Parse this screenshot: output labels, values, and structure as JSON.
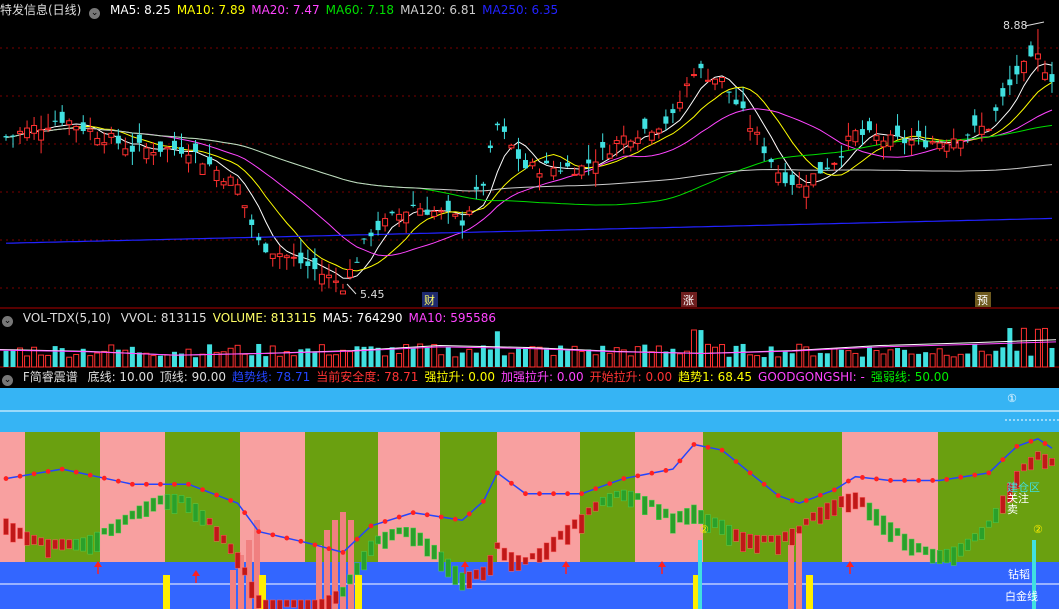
{
  "price_panel": {
    "title": "特发信息(日线)",
    "ma_legend": [
      {
        "label": "MA5: 8.25",
        "color": "#ffffff"
      },
      {
        "label": "MA10: 7.89",
        "color": "#ffff00"
      },
      {
        "label": "MA20: 7.47",
        "color": "#ff44ff"
      },
      {
        "label": "MA60: 7.18",
        "color": "#00dd00"
      },
      {
        "label": "MA120: 6.81",
        "color": "#cccccc"
      },
      {
        "label": "MA250: 6.35",
        "color": "#2222ff"
      }
    ],
    "high_label": "8.88",
    "low_label": "5.45",
    "markers": [
      "财",
      "涨",
      "预"
    ]
  },
  "volume_panel": {
    "title": "VOL-TDX(5,10)",
    "legend": [
      {
        "label": "VVOL: 813115",
        "color": "#dddddd"
      },
      {
        "label": "VOLUME: 813115",
        "color": "#ffff66"
      },
      {
        "label": "MA5: 764290",
        "color": "#ffffff"
      },
      {
        "label": "MA10: 595586",
        "color": "#ff44ff"
      }
    ]
  },
  "indicator_panel": {
    "title": "F简睿震谱",
    "legend": [
      {
        "label": "底线: 10.00",
        "color": "#dddddd"
      },
      {
        "label": "顶线: 90.00",
        "color": "#dddddd"
      },
      {
        "label": "趋势线: 78.71",
        "color": "#2244ff"
      },
      {
        "label": "当前安全度: 78.71",
        "color": "#ff3333"
      },
      {
        "label": "强拉升: 0.00",
        "color": "#ffff00"
      },
      {
        "label": "加强拉升: 0.00",
        "color": "#ff44ff"
      },
      {
        "label": "开始拉升: 0.00",
        "color": "#ff3333"
      },
      {
        "label": "趋势1: 68.45",
        "color": "#ffff00"
      },
      {
        "label": "GOODGONGSHI: -",
        "color": "#ff44ff"
      },
      {
        "label": "强弱线: 50.00",
        "color": "#00ee00"
      }
    ],
    "zone_labels": {
      "top_marker": "①",
      "build_zone": "建仓区",
      "watch": "关注",
      "sell": "卖",
      "buy_mark": "②",
      "drill_bottom": "钻韬",
      "gold_line": "白金线"
    }
  },
  "colors": {
    "up": "#ff3030",
    "down": "#40e0e0",
    "background": "#000000",
    "grid": "#8b0000",
    "band_pink": "#f8a0a0",
    "band_green": "#6aa010",
    "band_cyan": "#36b4f4",
    "band_blue": "#3366ff"
  },
  "chart_data": [
    {
      "type": "candlestick",
      "title": "特发信息(日线)",
      "series": [
        {
          "name": "MA5",
          "last": 8.25
        },
        {
          "name": "MA10",
          "last": 7.89
        },
        {
          "name": "MA20",
          "last": 7.47
        },
        {
          "name": "MA60",
          "last": 7.18
        },
        {
          "name": "MA120",
          "last": 6.81
        },
        {
          "name": "MA250",
          "last": 6.35
        }
      ],
      "annotations": {
        "high": 8.88,
        "low": 5.45
      }
    },
    {
      "type": "bar",
      "title": "VOL-TDX(5,10)",
      "series": [
        {
          "name": "VVOL",
          "last": 813115
        },
        {
          "name": "VOLUME",
          "last": 813115
        },
        {
          "name": "MA5",
          "last": 764290
        },
        {
          "name": "MA10",
          "last": 595586
        }
      ]
    },
    {
      "type": "line",
      "title": "F简睿震谱",
      "series": [
        {
          "name": "底线",
          "last": 10.0
        },
        {
          "name": "顶线",
          "last": 90.0
        },
        {
          "name": "趋势线",
          "last": 78.71
        },
        {
          "name": "当前安全度",
          "last": 78.71
        },
        {
          "name": "强拉升",
          "last": 0.0
        },
        {
          "name": "加强拉升",
          "last": 0.0
        },
        {
          "name": "开始拉升",
          "last": 0.0
        },
        {
          "name": "趋势1",
          "last": 68.45
        },
        {
          "name": "强弱线",
          "last": 50.0
        }
      ]
    }
  ]
}
